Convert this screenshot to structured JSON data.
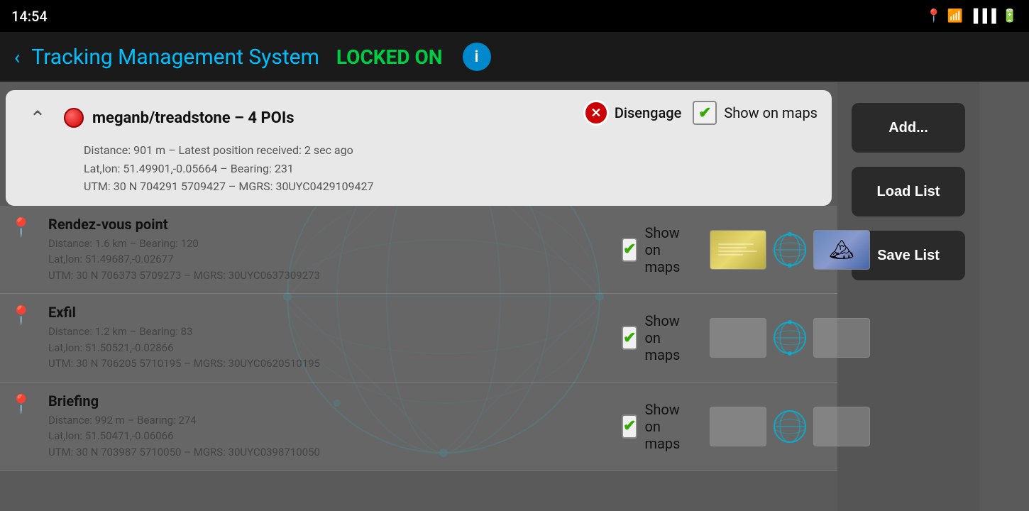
{
  "statusBar": {
    "time": "14:54",
    "icons": [
      "📍",
      "📶",
      "📶",
      "🔋"
    ]
  },
  "titleBar": {
    "backLabel": "‹",
    "title": "Tracking Management System",
    "lockedLabel": "LOCKED ON",
    "infoLabel": "i"
  },
  "header": {
    "title": "meganb/treadstone – 4 POIs",
    "distance": "Distance: 901 m – Latest position received: 2 sec ago",
    "latlon": "Lat,lon: 51.49901,-0.05664 – Bearing: 231",
    "utm": "UTM: 30 N 704291 5709427 – MGRS: 30UYC0429109427",
    "disengage": "Disengage",
    "showMaps": "Show on maps"
  },
  "pois": [
    {
      "name": "Rendez-vous point",
      "distance": "Distance: 1.6 km – Bearing: 120",
      "latlon": "Lat,lon: 51.49687,-0.02677",
      "utm": "UTM: 30 N 706373 5709273 – MGRS: 30UYC0637309273",
      "showMaps": "Show on maps"
    },
    {
      "name": "Exfil",
      "distance": "Distance: 1.2 km – Bearing: 83",
      "latlon": "Lat,lon: 51.50521,-0.02866",
      "utm": "UTM: 30 N 706205 5710195 – MGRS: 30UYC0620510195",
      "showMaps": "Show on maps"
    },
    {
      "name": "Briefing",
      "distance": "Distance: 992 m – Bearing: 274",
      "latlon": "Lat,lon: 51.50471,-0.06066",
      "utm": "UTM: 30 N 703987 5710050 – MGRS: 30UYC0398710050",
      "showMaps": "Show on maps"
    }
  ],
  "sidebar": {
    "addLabel": "Add...",
    "loadListLabel": "Load List",
    "saveListLabel": "Save List"
  }
}
